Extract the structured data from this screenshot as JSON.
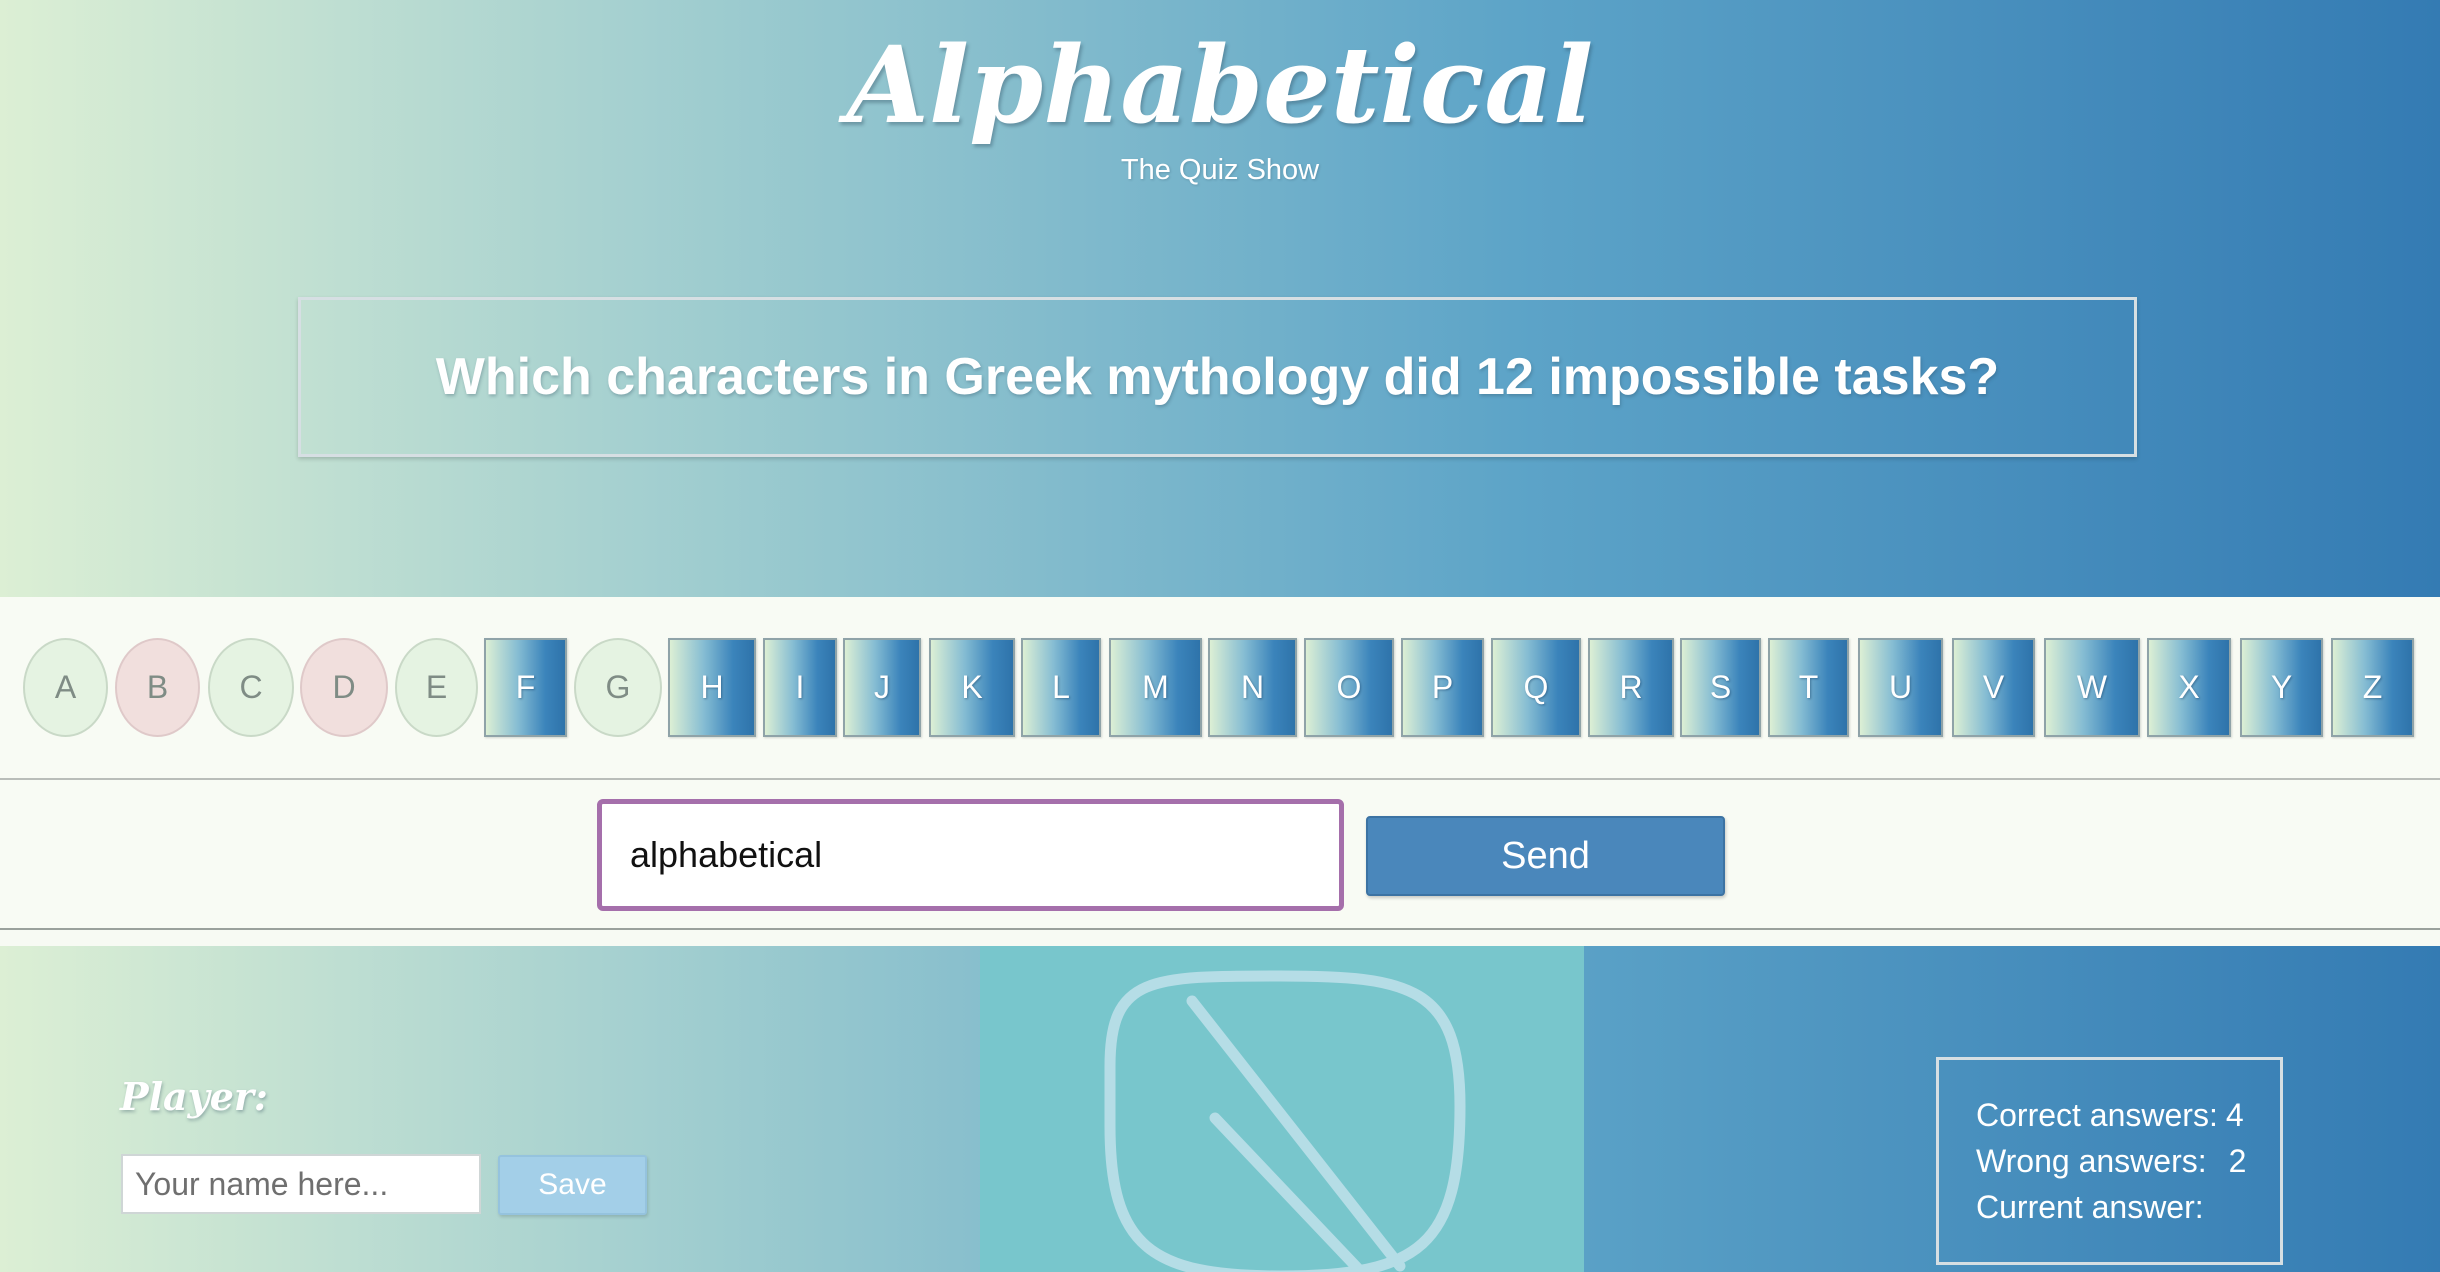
{
  "app": {
    "title": "Alphabetical",
    "subtitle": "The Quiz Show"
  },
  "question": {
    "text": "Which characters in Greek mythology did 12 impossible tasks?"
  },
  "letters": [
    {
      "letter": "A",
      "state": "correct"
    },
    {
      "letter": "B",
      "state": "wrong"
    },
    {
      "letter": "C",
      "state": "correct"
    },
    {
      "letter": "D",
      "state": "wrong"
    },
    {
      "letter": "E",
      "state": "correct"
    },
    {
      "letter": "F",
      "state": "available"
    },
    {
      "letter": "G",
      "state": "correct"
    },
    {
      "letter": "H",
      "state": "available"
    },
    {
      "letter": "I",
      "state": "available"
    },
    {
      "letter": "J",
      "state": "available"
    },
    {
      "letter": "K",
      "state": "available"
    },
    {
      "letter": "L",
      "state": "available"
    },
    {
      "letter": "M",
      "state": "available"
    },
    {
      "letter": "N",
      "state": "available"
    },
    {
      "letter": "O",
      "state": "available"
    },
    {
      "letter": "P",
      "state": "available"
    },
    {
      "letter": "Q",
      "state": "available"
    },
    {
      "letter": "R",
      "state": "available"
    },
    {
      "letter": "S",
      "state": "available"
    },
    {
      "letter": "T",
      "state": "available"
    },
    {
      "letter": "U",
      "state": "available"
    },
    {
      "letter": "V",
      "state": "available"
    },
    {
      "letter": "W",
      "state": "available"
    },
    {
      "letter": "X",
      "state": "available"
    },
    {
      "letter": "Y",
      "state": "available"
    },
    {
      "letter": "Z",
      "state": "available"
    }
  ],
  "answer": {
    "value": "alphabetical",
    "send_label": "Send"
  },
  "player": {
    "label": "Player:",
    "name_placeholder": "Your name here...",
    "save_label": "Save"
  },
  "status": {
    "icon": "blocked-icon"
  },
  "score": {
    "correct_label": "Correct answers:",
    "correct_value": "4",
    "wrong_label": "Wrong answers:",
    "wrong_value": "2",
    "current_label": "Current answer:",
    "current_value": ""
  },
  "colors": {
    "gradient_start": "#dcefd4",
    "gradient_end": "#347bb3",
    "correct_letter": "#e5f3e2",
    "wrong_letter": "#f1dfdd",
    "send_button": "#4a87bb",
    "input_border": "#a56fab"
  }
}
